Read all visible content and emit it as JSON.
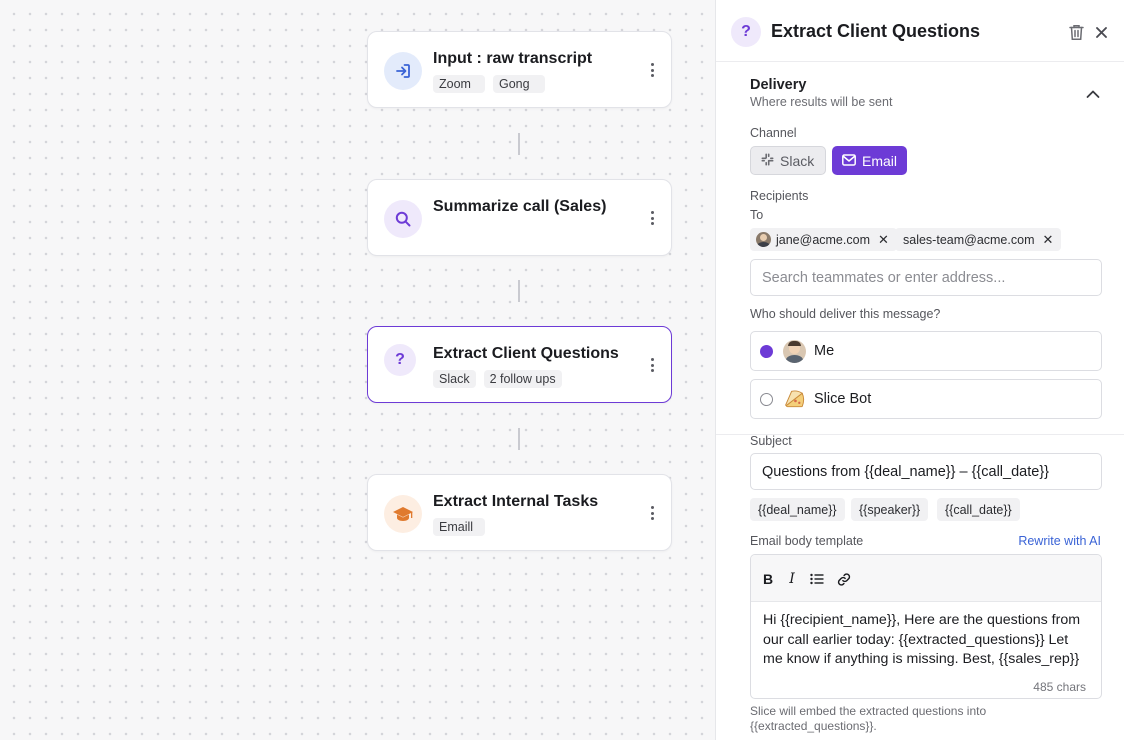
{
  "canvas": {
    "nodes": [
      {
        "title": "Input : raw transcript",
        "tags": [
          "Zoom",
          "Gong"
        ],
        "icon": "input-icon"
      },
      {
        "title": "Summarize call (Sales)",
        "tags": [],
        "icon": "search-icon"
      },
      {
        "title": "Extract Client Questions",
        "tags": [
          "Slack",
          "2 follow ups"
        ],
        "icon": "question-icon",
        "selected": true
      },
      {
        "title": "Extract Internal Tasks",
        "tags": [
          "Emaill"
        ],
        "icon": "graduation-cap-icon"
      }
    ]
  },
  "panel": {
    "icon_glyph": "?",
    "title": "Extract Client Questions",
    "delivery": {
      "title": "Delivery",
      "subtitle": "Where results will be sent",
      "channel_label": "Channel",
      "channels": [
        {
          "label": "Slack",
          "active": false
        },
        {
          "label": "Email",
          "active": true
        }
      ],
      "recipients_label": "Recipients",
      "to_label": "To",
      "recipients": [
        "jane@acme.com",
        "sales-team@acme.com"
      ],
      "search_placeholder": "Search teammates or enter address...",
      "deliver_question": "Who should deliver this message?",
      "senders": [
        {
          "label": "Me",
          "selected": true
        },
        {
          "label": "Slice Bot",
          "selected": false
        }
      ]
    },
    "subject_label": "Subject",
    "subject_value": "Questions from {{deal_name}} – {{call_date}}",
    "variables": [
      "{{deal_name}}",
      "{{speaker}}",
      "{{call_date}}"
    ],
    "body_label": "Email body template",
    "rewrite_label": "Rewrite with AI",
    "body_text": "Hi {{recipient_name}}, Here are the questions from our call earlier today: {{extracted_questions}} Let me know if anything is missing. Best, {{sales_rep}}",
    "char_count": "485 chars",
    "footnote": "Slice will embed the extracted questions into {{extracted_questions}}."
  },
  "colors": {
    "accent": "#6d3bd6",
    "link": "#3a63d6"
  }
}
